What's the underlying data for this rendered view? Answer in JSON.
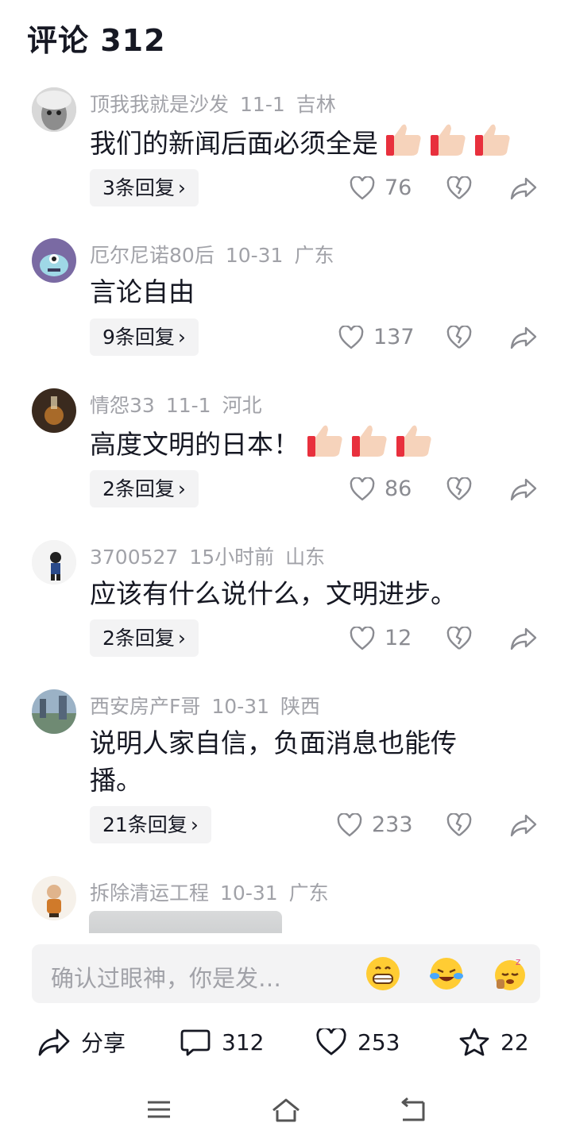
{
  "header": {
    "title": "评论 312"
  },
  "comments": [
    {
      "user": "顶我我就是沙发",
      "date": "11-1",
      "location": "吉林",
      "text": "我们的新闻后面必须全是",
      "thumbs": 3,
      "replies": "3条回复",
      "likes": "76"
    },
    {
      "user": "厄尔尼诺80后",
      "date": "10-31",
      "location": "广东",
      "text": "言论自由",
      "thumbs": 0,
      "replies": "9条回复",
      "likes": "137"
    },
    {
      "user": "情怨33",
      "date": "11-1",
      "location": "河北",
      "text": "高度文明的日本！",
      "thumbs": 3,
      "replies": "2条回复",
      "likes": "86"
    },
    {
      "user": "3700527",
      "date": "15小时前",
      "location": "山东",
      "text": "应该有什么说什么，文明进步。",
      "thumbs": 0,
      "replies": "2条回复",
      "likes": "12"
    },
    {
      "user": "西安房产F哥",
      "date": "10-31",
      "location": "陕西",
      "text": "说明人家自信，负面消息也能传播。",
      "thumbs": 0,
      "replies": "21条回复",
      "likes": "233"
    },
    {
      "user": "拆除清运工程",
      "date": "10-31",
      "location": "广东"
    }
  ],
  "input": {
    "placeholder": "确认过眼神，你是发…"
  },
  "emojis": [
    "grin-emoji",
    "laugh-cry-emoji",
    "sleepy-emoji"
  ],
  "actions": {
    "share_label": "分享",
    "comments_count": "312",
    "likes_count": "253",
    "favorites_count": "22"
  },
  "colors": {
    "muted": "#a1a2a8",
    "text": "#161823",
    "pill": "#f3f3f4"
  }
}
